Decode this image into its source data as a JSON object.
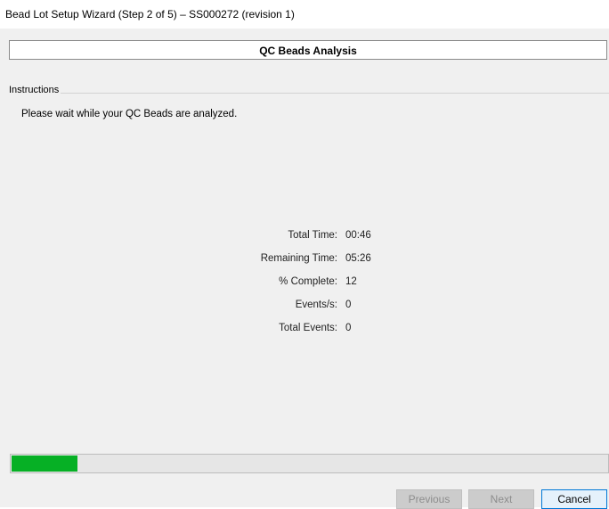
{
  "window": {
    "title": "Bead Lot Setup Wizard (Step 2 of 5) – SS000272 (revision 1)"
  },
  "header": {
    "title": "QC Beads Analysis"
  },
  "instructions": {
    "legend": "Instructions",
    "text": "Please wait while your QC Beads are analyzed."
  },
  "stats": [
    {
      "label": "Total Time:",
      "value": "00:46"
    },
    {
      "label": "Remaining Time:",
      "value": "05:26"
    },
    {
      "label": "% Complete:",
      "value": "12"
    },
    {
      "label": "Events/s:",
      "value": "0"
    },
    {
      "label": "Total Events:",
      "value": "0"
    }
  ],
  "progress": {
    "fraction": 0.11,
    "fill_color": "#06b025"
  },
  "buttons": {
    "previous": "Previous",
    "next": "Next",
    "cancel": "Cancel"
  }
}
